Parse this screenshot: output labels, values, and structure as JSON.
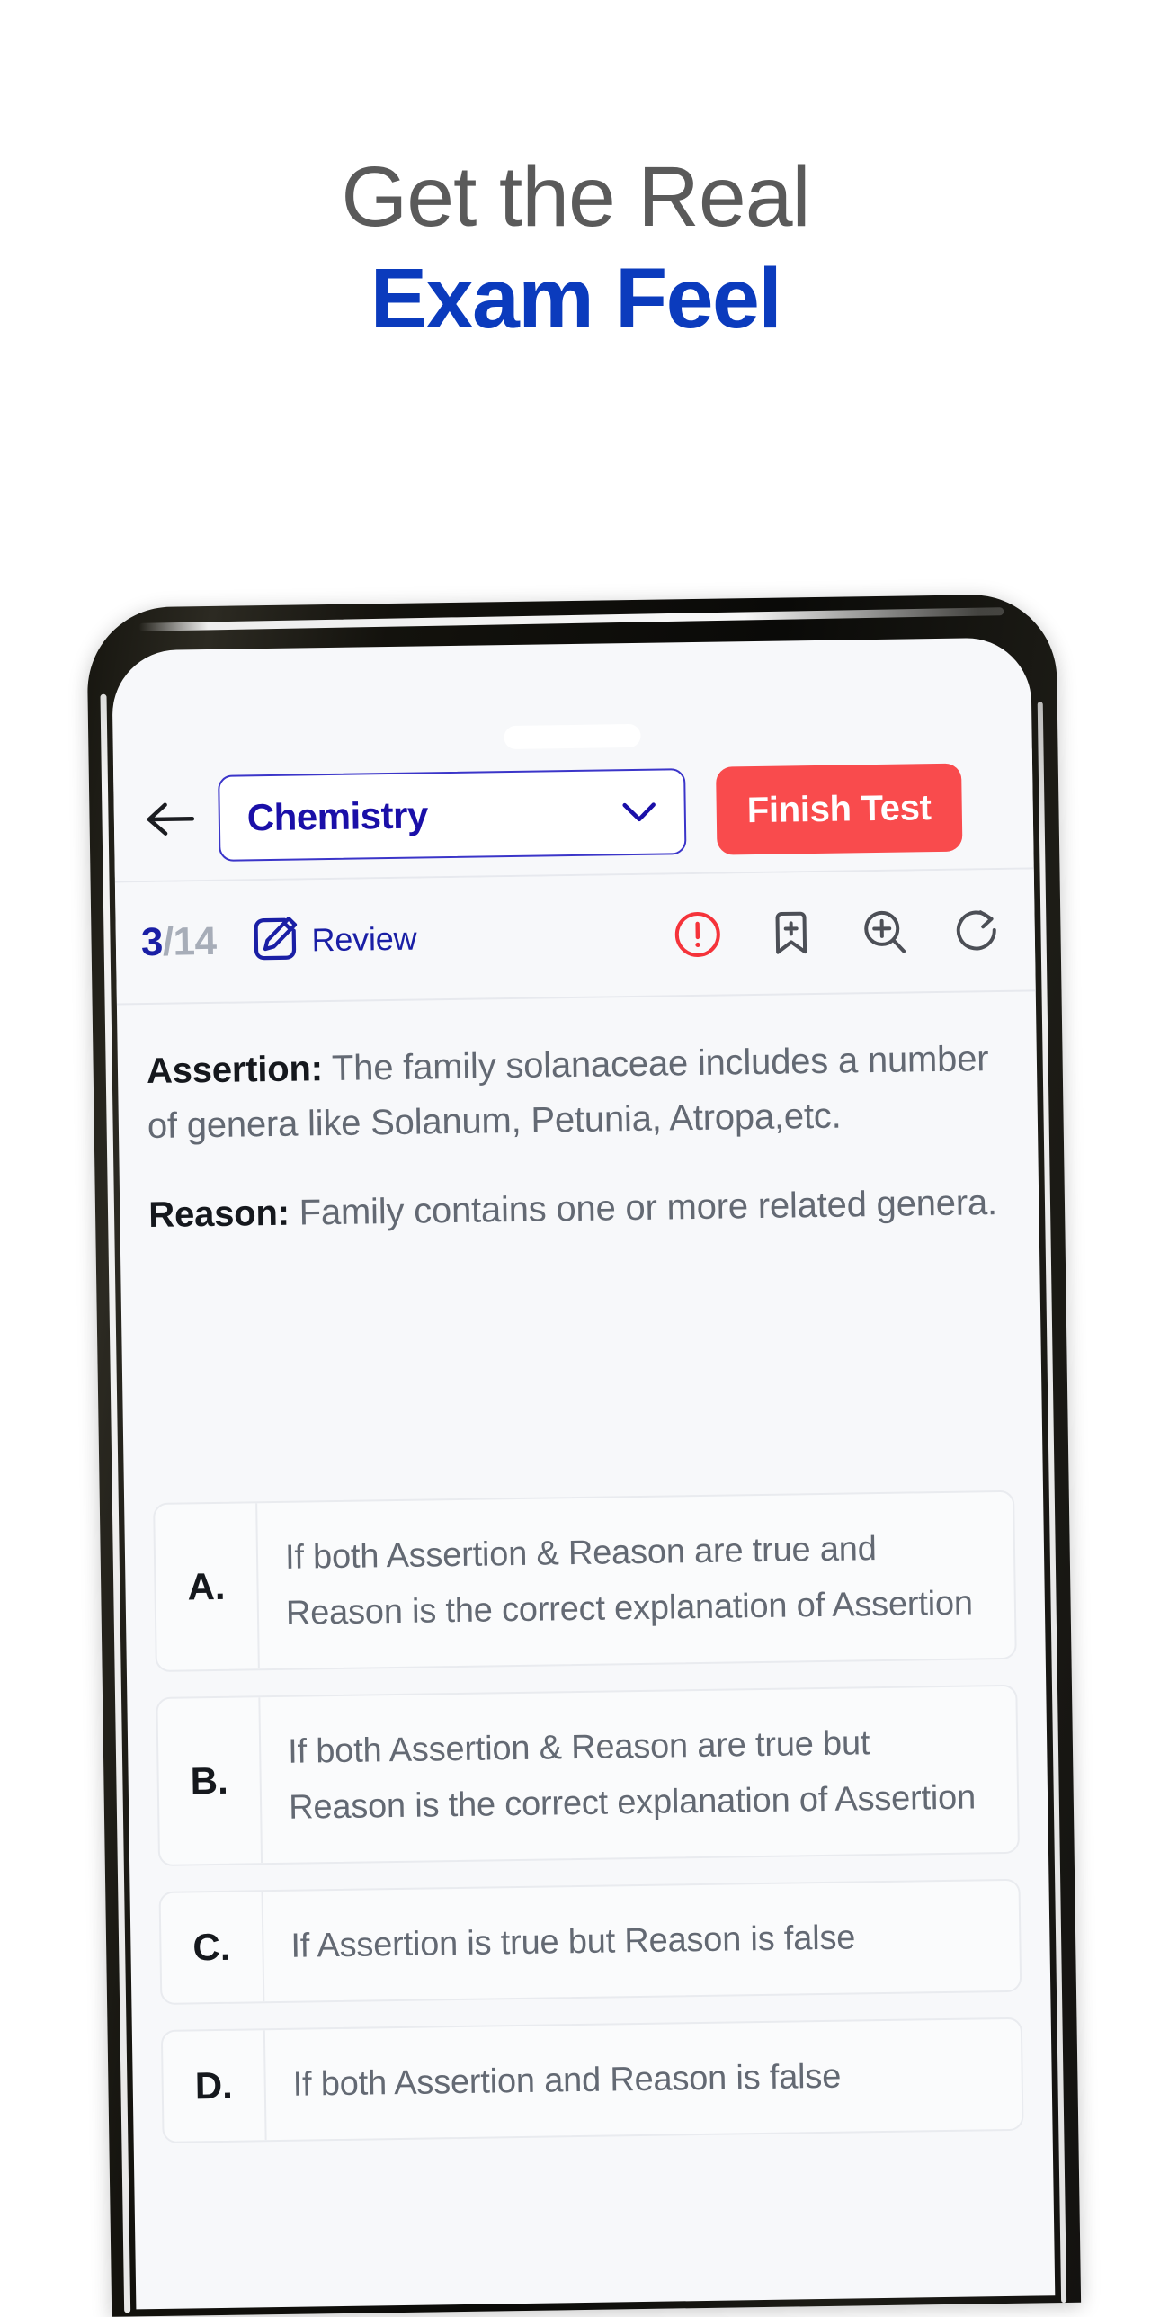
{
  "headline": {
    "line1": "Get the Real",
    "line2": "Exam Feel"
  },
  "colors": {
    "headline_gray": "#5a5a5a",
    "headline_blue": "#0b3bbd",
    "accent_indigo": "#1a0fa8",
    "danger_red": "#f94b4d",
    "screen_bg": "#f7f8fa",
    "muted_text": "#636973"
  },
  "app": {
    "header": {
      "back_icon": "arrow-left-icon",
      "subject": {
        "value": "Chemistry",
        "chevron_icon": "chevron-down-icon"
      },
      "finish_button": "Finish Test"
    },
    "toolbar": {
      "current_question": "3",
      "total_questions": "/14",
      "review_icon": "pencil-square-icon",
      "review_label": "Review",
      "icons": [
        {
          "name": "report-alert-icon",
          "glyph": "!"
        },
        {
          "name": "bookmark-add-icon",
          "glyph": "+"
        },
        {
          "name": "zoom-in-icon",
          "glyph": "+"
        },
        {
          "name": "reset-redo-icon",
          "glyph": "redo"
        }
      ]
    },
    "question": {
      "assertion_label": "Assertion:",
      "assertion_text": " The family solanaceae includes a number of genera like Solanum, Petunia, Atropa,etc.",
      "reason_label": "Reason:",
      "reason_text": " Family contains one or more related genera."
    },
    "options": [
      {
        "letter": "A.",
        "text": "If both Assertion & Reason are true and Reason is the correct explanation of Assertion"
      },
      {
        "letter": "B.",
        "text": "If both Assertion & Reason are true but Reason is the correct explanation of Assertion"
      },
      {
        "letter": "C.",
        "text": "If Assertion is true but Reason is false"
      },
      {
        "letter": "D.",
        "text": "If both Assertion and Reason is false"
      }
    ]
  }
}
